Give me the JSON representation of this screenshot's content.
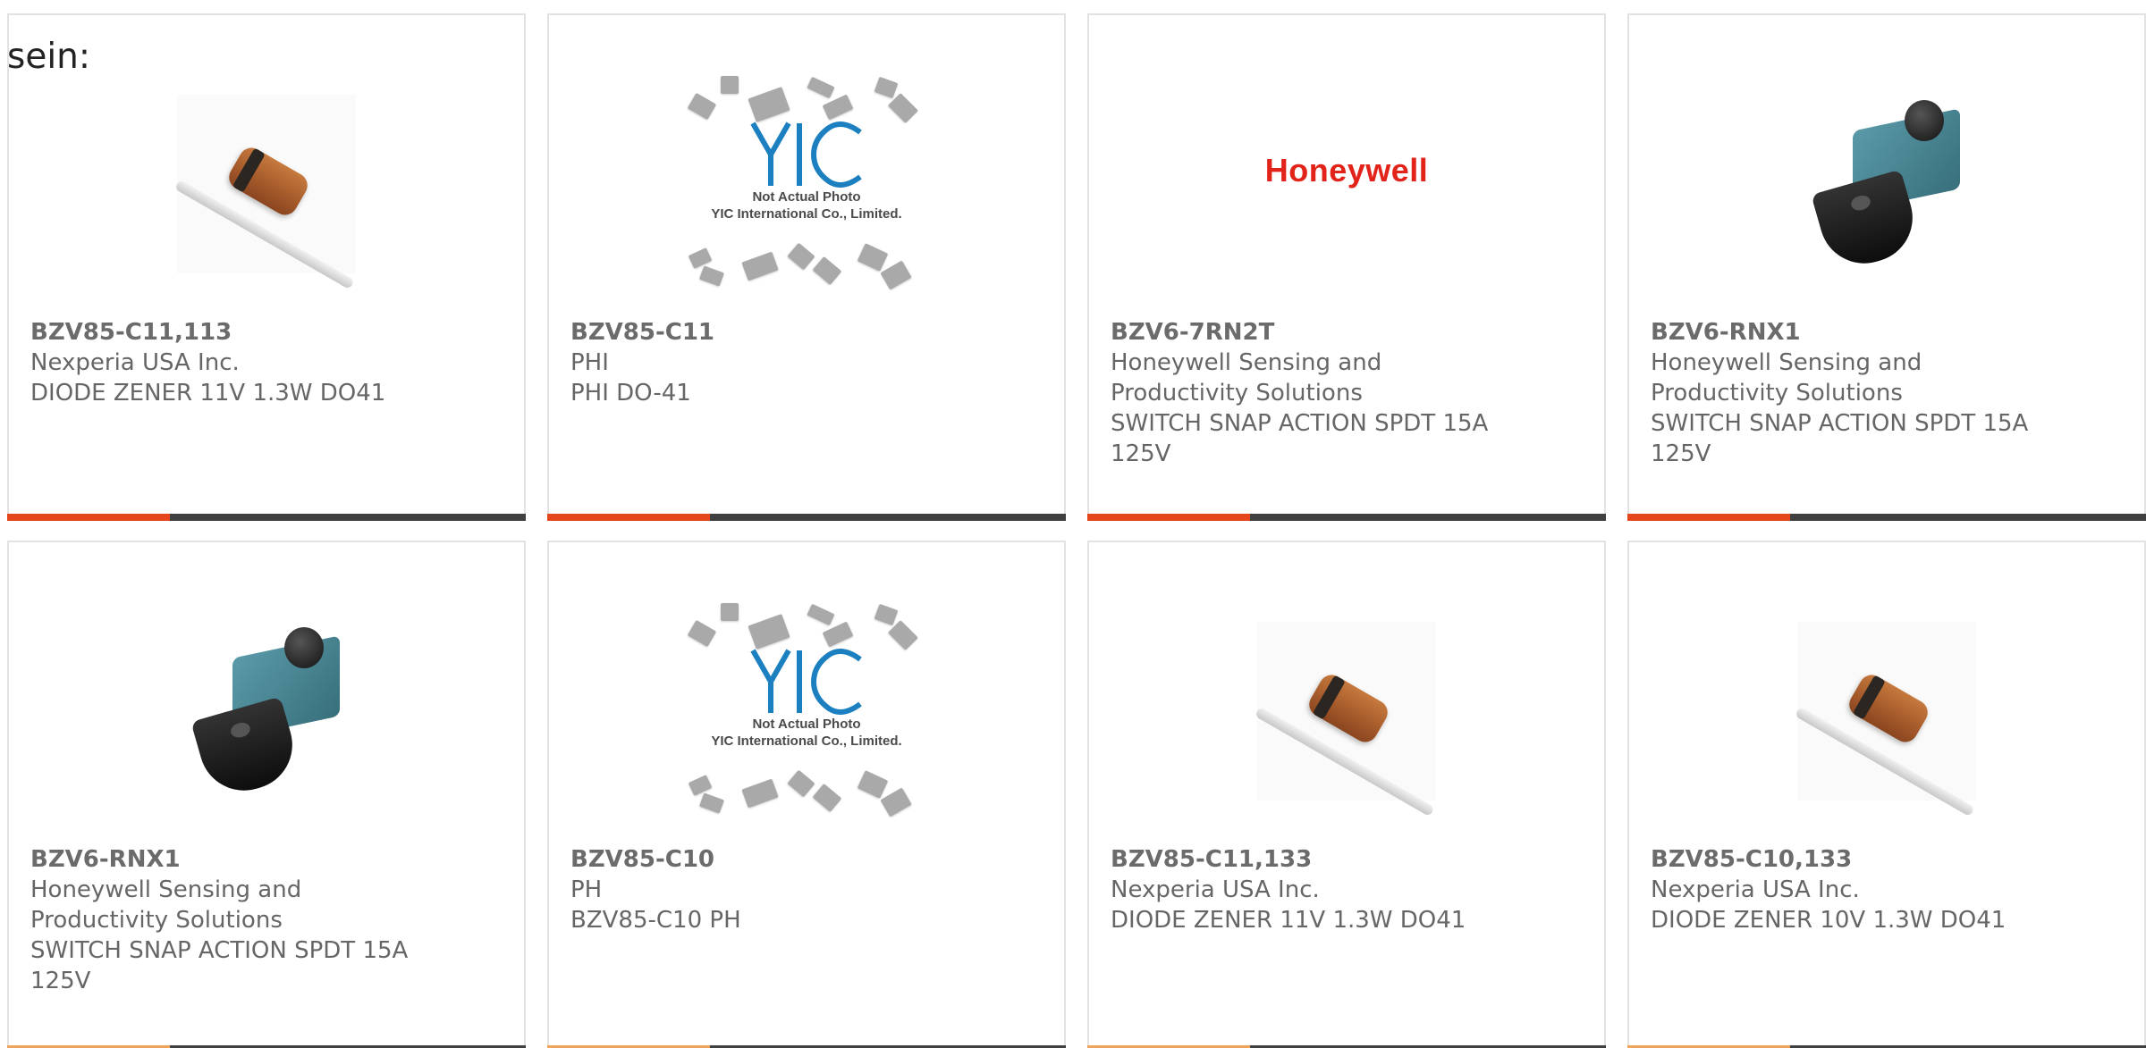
{
  "intro_text": "sein:",
  "colors": {
    "accent": "#e5461b",
    "bar": "#404040",
    "brand_honeywell": "#e2231a",
    "yic_blue": "#1b7fc0"
  },
  "cards": [
    {
      "part_number": "BZV85-C11,113",
      "lines": [
        "Nexperia USA Inc.",
        "DIODE ZENER 11V 1.3W DO41"
      ],
      "image": "diode-photo"
    },
    {
      "part_number": "BZV85-C11",
      "lines": [
        "PHI",
        "PHI DO-41"
      ],
      "image": "yic-placeholder",
      "image_text": [
        "Not Actual Photo",
        "YIC International Co., Limited."
      ],
      "image_logo": "YIC"
    },
    {
      "part_number": "BZV6-7RN2T",
      "lines": [
        "Honeywell Sensing and",
        "Productivity Solutions",
        "SWITCH SNAP ACTION SPDT 15A",
        "125V"
      ],
      "image": "honeywell-logo",
      "image_text": [
        "Honeywell"
      ]
    },
    {
      "part_number": "BZV6-RNX1",
      "lines": [
        "Honeywell Sensing and",
        "Productivity Solutions",
        "SWITCH SNAP ACTION SPDT 15A",
        "125V"
      ],
      "image": "switch-photo"
    },
    {
      "part_number": "BZV6-RNX1",
      "lines": [
        "Honeywell Sensing and",
        "Productivity Solutions",
        "SWITCH SNAP ACTION SPDT 15A",
        "125V"
      ],
      "image": "switch-photo"
    },
    {
      "part_number": "BZV85-C10",
      "lines": [
        "PH",
        "BZV85-C10 PH"
      ],
      "image": "yic-placeholder",
      "image_text": [
        "Not Actual Photo",
        "YIC International Co., Limited."
      ],
      "image_logo": "YIC"
    },
    {
      "part_number": "BZV85-C11,133",
      "lines": [
        "Nexperia USA Inc.",
        "DIODE ZENER 11V 1.3W DO41"
      ],
      "image": "diode-photo"
    },
    {
      "part_number": "BZV85-C10,133",
      "lines": [
        "Nexperia USA Inc.",
        "DIODE ZENER 10V 1.3W DO41"
      ],
      "image": "diode-photo"
    }
  ]
}
